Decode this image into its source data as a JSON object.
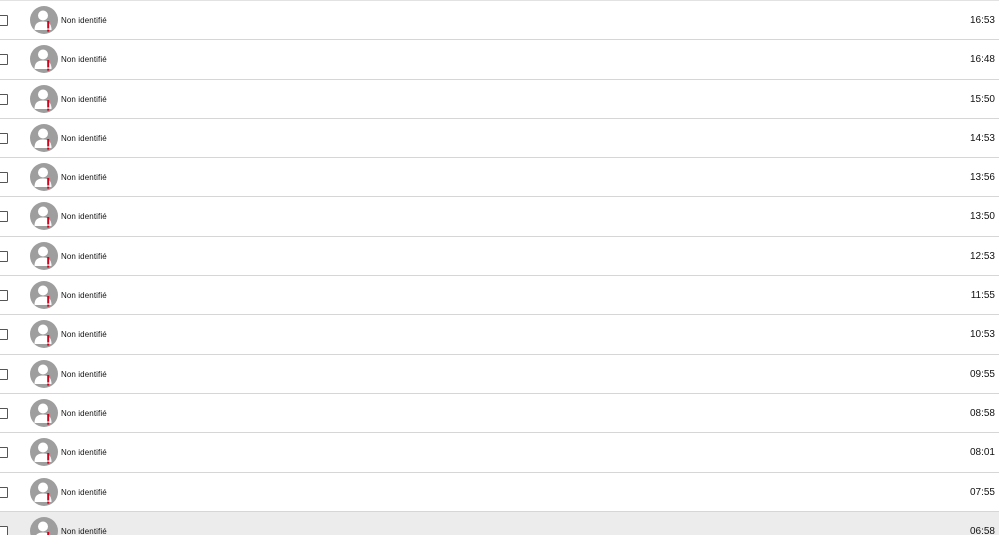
{
  "messages": [
    {
      "sender": "Non identifié",
      "time": "16:53",
      "avatar_icon": "unknown-user-warning-icon"
    },
    {
      "sender": "Non identifié",
      "time": "16:48",
      "avatar_icon": "unknown-user-warning-icon"
    },
    {
      "sender": "Non identifié",
      "time": "15:50",
      "avatar_icon": "unknown-user-warning-icon"
    },
    {
      "sender": "Non identifié",
      "time": "14:53",
      "avatar_icon": "unknown-user-warning-icon"
    },
    {
      "sender": "Non identifié",
      "time": "13:56",
      "avatar_icon": "unknown-user-warning-icon"
    },
    {
      "sender": "Non identifié",
      "time": "13:50",
      "avatar_icon": "unknown-user-warning-icon"
    },
    {
      "sender": "Non identifié",
      "time": "12:53",
      "avatar_icon": "unknown-user-warning-icon"
    },
    {
      "sender": "Non identifié",
      "time": "11:55",
      "avatar_icon": "unknown-user-warning-icon"
    },
    {
      "sender": "Non identifié",
      "time": "10:53",
      "avatar_icon": "unknown-user-warning-icon"
    },
    {
      "sender": "Non identifié",
      "time": "09:55",
      "avatar_icon": "unknown-user-warning-icon"
    },
    {
      "sender": "Non identifié",
      "time": "08:58",
      "avatar_icon": "unknown-user-warning-icon"
    },
    {
      "sender": "Non identifié",
      "time": "08:01",
      "avatar_icon": "unknown-user-warning-icon"
    },
    {
      "sender": "Non identifié",
      "time": "07:55",
      "avatar_icon": "unknown-user-warning-icon"
    },
    {
      "sender": "Non identifié",
      "time": "06:58",
      "avatar_icon": "unknown-user-warning-icon",
      "highlighted": true
    }
  ],
  "colors": {
    "avatar_gray": "#9e9e9e",
    "warning_red": "#d0021b",
    "row_highlight": "#ececec",
    "divider": "#d6d6d6"
  }
}
